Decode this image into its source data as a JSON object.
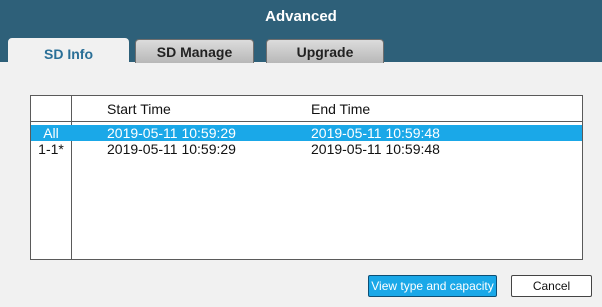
{
  "window": {
    "title": "Advanced"
  },
  "tabs": [
    {
      "label": "SD Info"
    },
    {
      "label": "SD Manage"
    },
    {
      "label": "Upgrade"
    }
  ],
  "table": {
    "columns": [
      "Start Time",
      "End Time"
    ],
    "rows": [
      {
        "id": "All",
        "start": "2019-05-11 10:59:29",
        "end": "2019-05-11 10:59:48",
        "selected": true
      },
      {
        "id": "1-1*",
        "start": "2019-05-11 10:59:29",
        "end": "2019-05-11 10:59:48",
        "selected": false
      }
    ]
  },
  "buttons": {
    "view_label": "View type and capacity",
    "cancel_label": "Cancel"
  },
  "colors": {
    "header": "#2e6079",
    "selection": "#1aa8e8",
    "active_tab_text": "#2a6f97"
  }
}
